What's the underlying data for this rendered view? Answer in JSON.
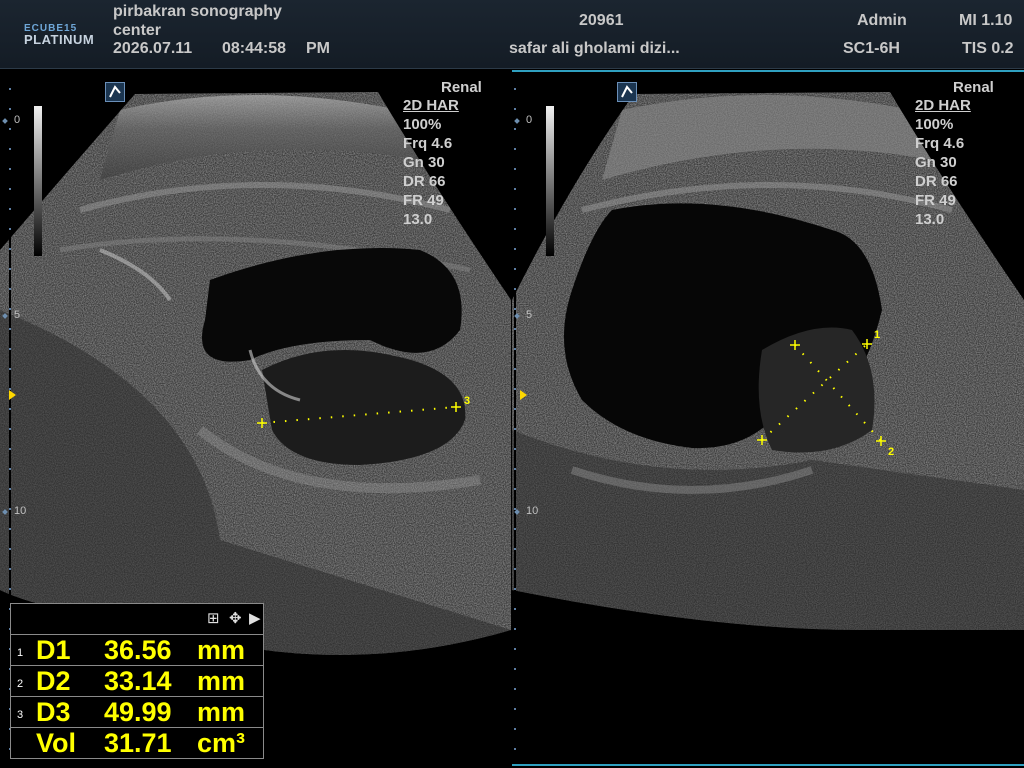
{
  "header": {
    "logo_line1": "ECUBE",
    "logo_model": "15",
    "logo_line2": "PLATINUM",
    "facility_line1": "pirbakran sonography",
    "facility_line2": "center",
    "date": "2026.07.11",
    "time": "08:44:58",
    "ampm": "PM",
    "patient_id": "20961",
    "patient_name": "safar ali gholami dizi...",
    "operator": "Admin",
    "probe": "SC1-6H",
    "mi": "MI 1.10",
    "tis": "TIS 0.2"
  },
  "left_view": {
    "preset": "Renal",
    "mode": "2D HAR",
    "power": "100%",
    "frequency": "Frq 4.6",
    "gain": "Gn 30",
    "dynamic_range": "DR 66",
    "frame_rate": "FR 49",
    "depth": "13.0",
    "depth_labels": [
      "0",
      "5",
      "10"
    ],
    "calipers": [
      "3"
    ]
  },
  "right_view": {
    "preset": "Renal",
    "mode": "2D HAR",
    "power": "100%",
    "frequency": "Frq 4.6",
    "gain": "Gn 30",
    "dynamic_range": "DR 66",
    "frame_rate": "FR 49",
    "depth": "13.0",
    "depth_labels": [
      "0",
      "5",
      "10"
    ],
    "calipers": [
      "1",
      "2"
    ]
  },
  "measurements": [
    {
      "index": "1",
      "label": "D1",
      "value": "36.56",
      "unit": "mm"
    },
    {
      "index": "2",
      "label": "D2",
      "value": "33.14",
      "unit": "mm"
    },
    {
      "index": "3",
      "label": "D3",
      "value": "49.99",
      "unit": "mm"
    },
    {
      "index": "",
      "label": "Vol",
      "value": "31.71",
      "unit": "cm³"
    }
  ],
  "colors": {
    "caliper": "#ffff00",
    "accent": "#2fa0c0",
    "depth_marker": "#6e8fb0"
  },
  "icons": [
    "probe-orientation-icon",
    "layout-icon",
    "move-icon",
    "expand-arrow-icon"
  ]
}
